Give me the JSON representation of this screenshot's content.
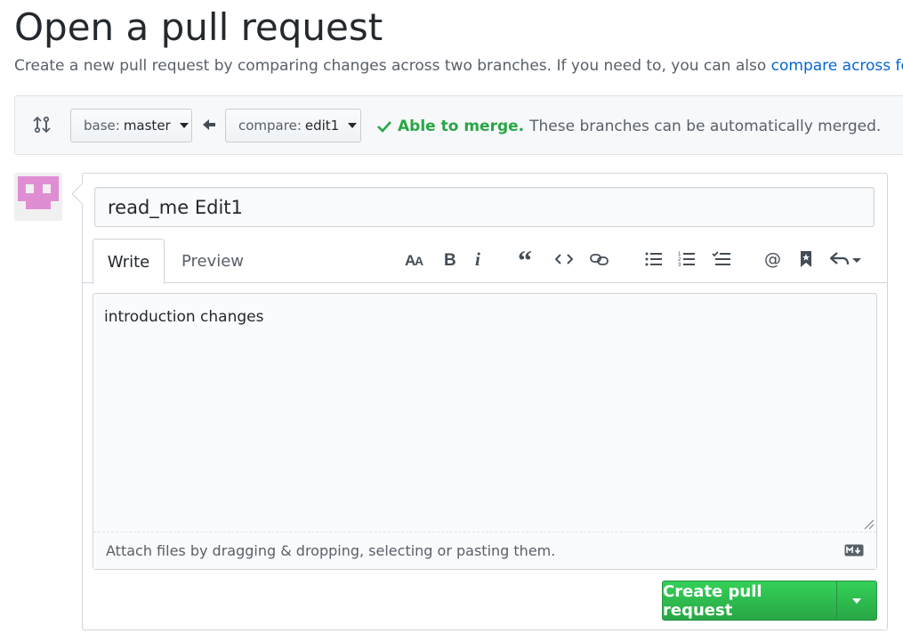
{
  "header": {
    "title": "Open a pull request",
    "subtitle": "Create a new pull request by comparing changes across two branches. If you need to, you can also ",
    "subtitle_link": "compare across forks"
  },
  "range": {
    "base_prefix": "base:",
    "base_branch": "master",
    "compare_prefix": "compare:",
    "compare_branch": "edit1",
    "merge_ok": "Able to merge.",
    "merge_message": "These branches can be automatically merged."
  },
  "form": {
    "title_value": "read_me Edit1",
    "tabs": [
      {
        "label": "Write"
      },
      {
        "label": "Preview"
      }
    ],
    "toolbar_icons": [
      "text-size-icon",
      "bold-icon",
      "italic-icon",
      "quote-icon",
      "code-icon",
      "link-icon",
      "bullet-list-icon",
      "numbered-list-icon",
      "task-list-icon",
      "mention-icon",
      "saved-reply-icon",
      "reply-icon"
    ],
    "body_text": "introduction changes",
    "attach_hint": "Attach files by dragging & dropping, selecting or pasting them.",
    "submit_label": "Create pull request"
  },
  "colors": {
    "accent_link": "#0366d6",
    "success": "#28a745",
    "avatar": "#e08ed4"
  }
}
